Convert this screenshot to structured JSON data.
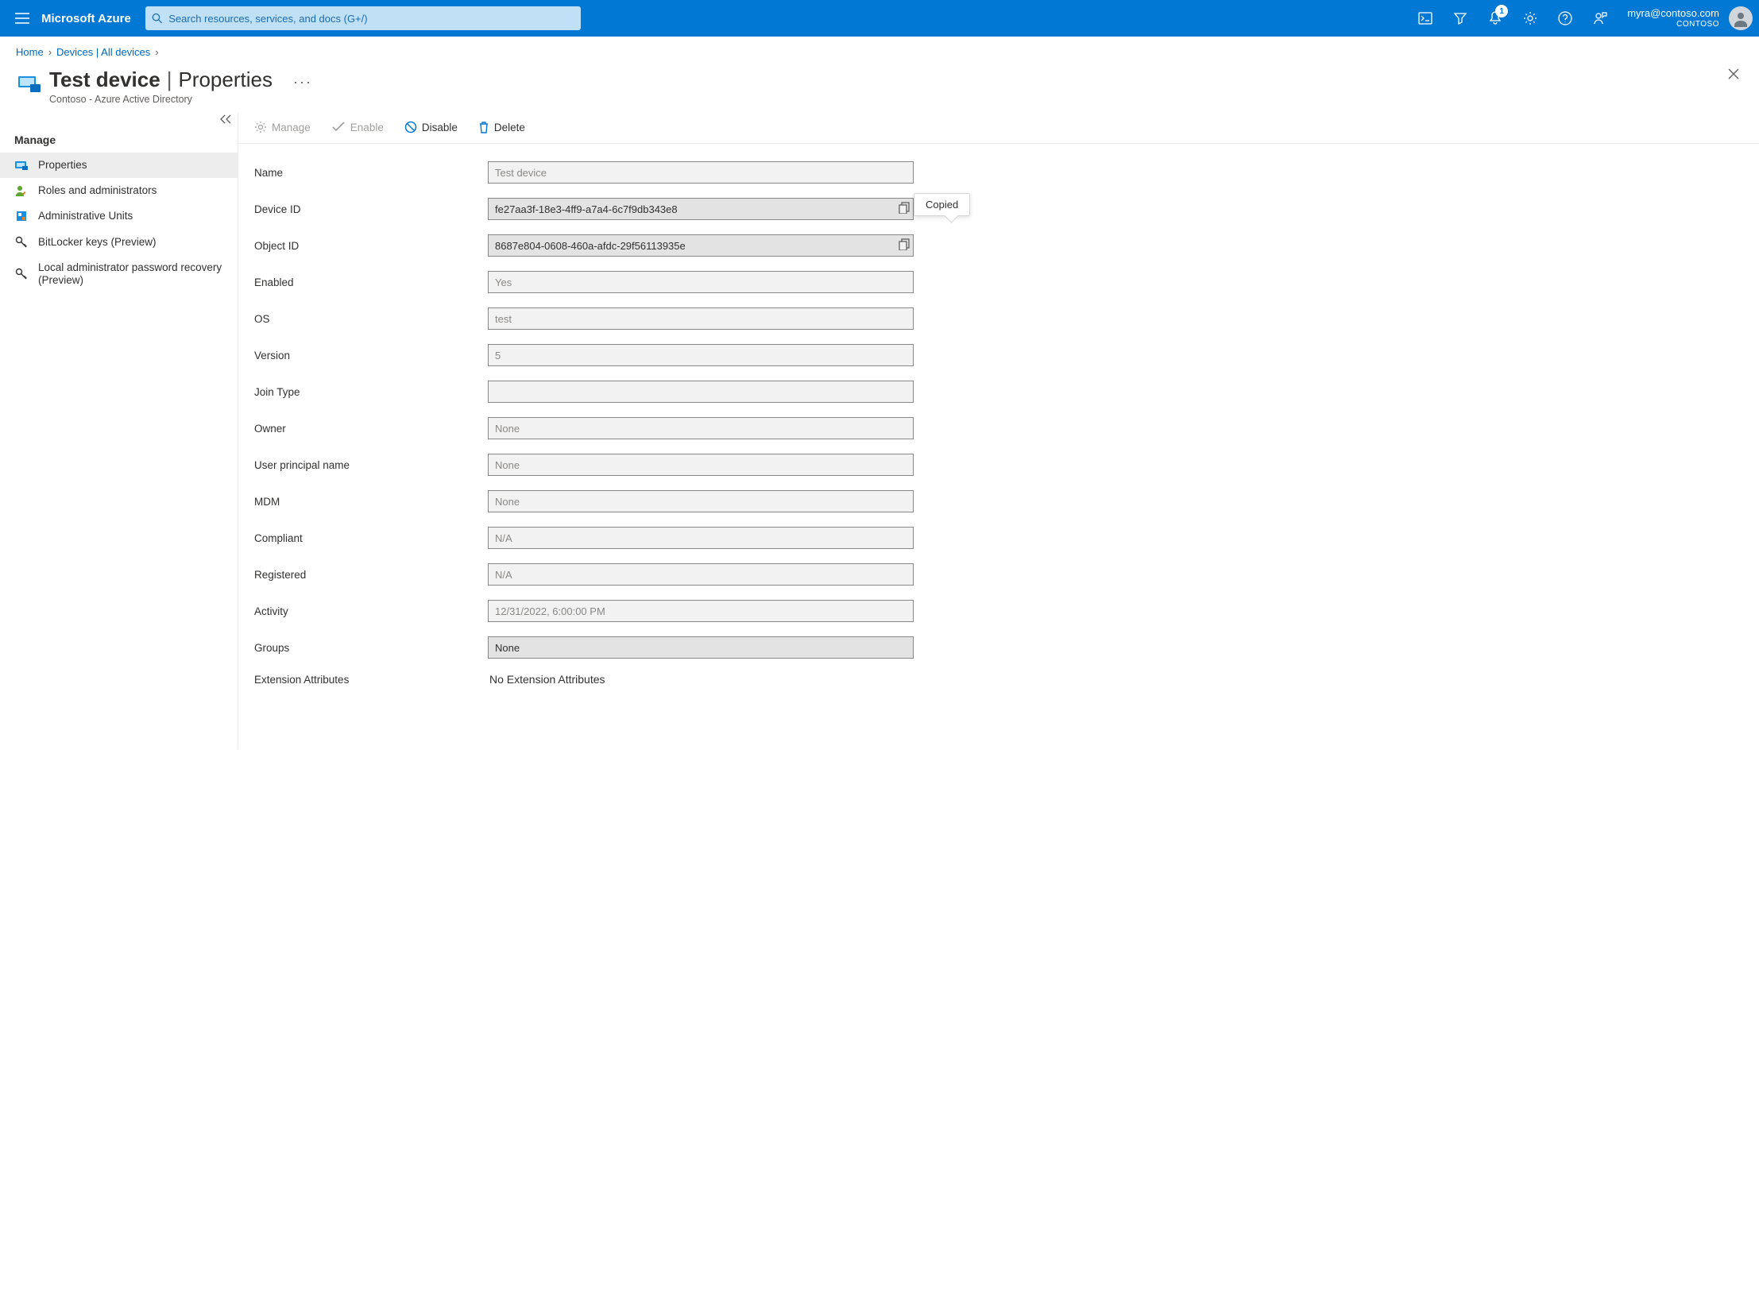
{
  "topbar": {
    "brand": "Microsoft Azure",
    "search_placeholder": "Search resources, services, and docs (G+/)",
    "notification_badge": "1",
    "account_email": "myra@contoso.com",
    "account_tenant": "CONTOSO"
  },
  "breadcrumb": {
    "items": [
      "Home",
      "Devices | All devices"
    ]
  },
  "header": {
    "title_main": "Test device",
    "title_sub": "Properties",
    "subtitle": "Contoso - Azure Active Directory"
  },
  "nav": {
    "section": "Manage",
    "items": [
      {
        "label": "Properties",
        "selected": true
      },
      {
        "label": "Roles and administrators",
        "selected": false
      },
      {
        "label": "Administrative Units",
        "selected": false
      },
      {
        "label": "BitLocker keys (Preview)",
        "selected": false
      },
      {
        "label": "Local administrator password recovery (Preview)",
        "selected": false
      }
    ]
  },
  "toolbar": {
    "manage": "Manage",
    "enable": "Enable",
    "disable": "Disable",
    "delete": "Delete"
  },
  "tooltip": {
    "copied": "Copied"
  },
  "form": {
    "rows": [
      {
        "label": "Name",
        "value": "Test device",
        "placeholder": true
      },
      {
        "label": "Device ID",
        "value": "fe27aa3f-18e3-4ff9-a7a4-6c7f9db343e8",
        "copy": true,
        "darker": true,
        "tooltip": true
      },
      {
        "label": "Object ID",
        "value": "8687e804-0608-460a-afdc-29f56113935e",
        "copy": true,
        "darker": true
      },
      {
        "label": "Enabled",
        "value": "Yes",
        "placeholder": true
      },
      {
        "label": "OS",
        "value": "test",
        "placeholder": true
      },
      {
        "label": "Version",
        "value": "5",
        "placeholder": true
      },
      {
        "label": "Join Type",
        "value": ""
      },
      {
        "label": "Owner",
        "value": "None",
        "placeholder": true
      },
      {
        "label": "User principal name",
        "value": "None",
        "placeholder": true
      },
      {
        "label": "MDM",
        "value": "None",
        "placeholder": true
      },
      {
        "label": "Compliant",
        "value": "N/A",
        "placeholder": true
      },
      {
        "label": "Registered",
        "value": "N/A",
        "placeholder": true
      },
      {
        "label": "Activity",
        "value": "12/31/2022, 6:00:00 PM",
        "placeholder": true
      },
      {
        "label": "Groups",
        "value": "None",
        "darker": true,
        "link": true
      },
      {
        "label": "Extension Attributes",
        "value": "No Extension Attributes",
        "plain": true
      }
    ]
  }
}
